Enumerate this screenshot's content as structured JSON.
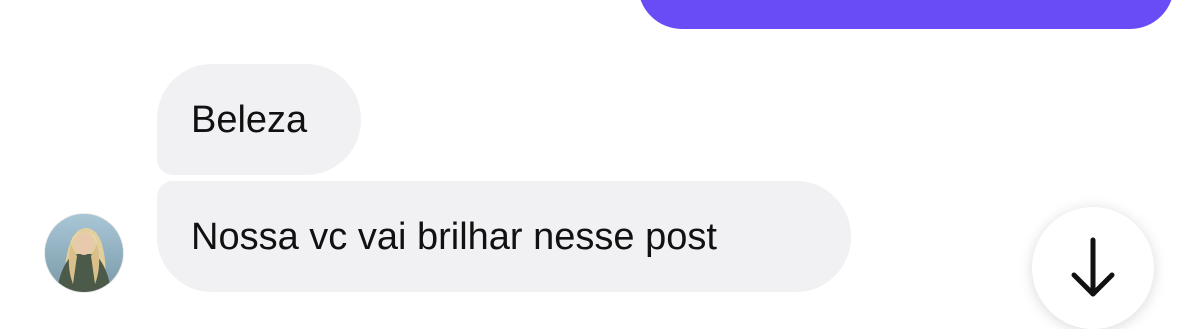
{
  "conversation": {
    "messages": [
      {
        "direction": "outgoing",
        "text": ""
      },
      {
        "direction": "incoming",
        "text": "Beleza"
      },
      {
        "direction": "incoming",
        "text": "Nossa vc vai brilhar nesse post"
      }
    ]
  },
  "avatar": {
    "icon": "contact-avatar-photo"
  },
  "scroll_button": {
    "icon": "arrow-down-icon"
  },
  "colors": {
    "outgoing_bubble": "#6a4cf7",
    "incoming_bubble": "#f1f1f4",
    "text": "#111111",
    "background": "#ffffff"
  }
}
